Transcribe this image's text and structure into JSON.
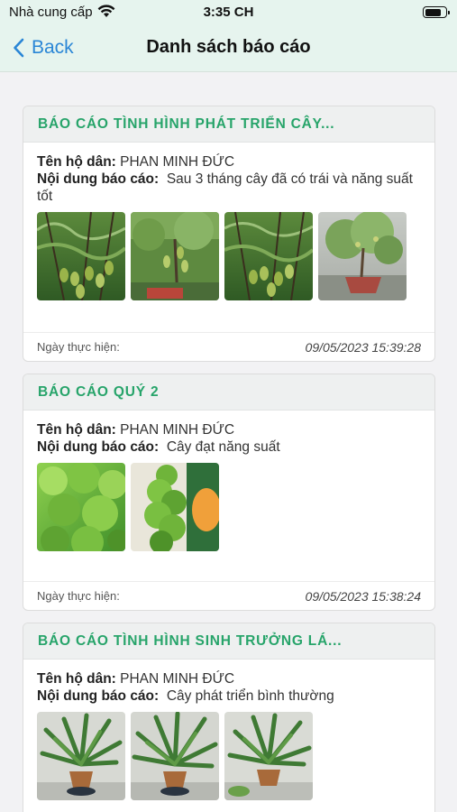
{
  "status": {
    "carrier": "Nhà cung cấp",
    "time": "3:35 CH",
    "battery_level": 0.85
  },
  "nav": {
    "back_label": "Back",
    "title": "Danh sách báo cáo"
  },
  "labels": {
    "household": "Tên hộ dân:",
    "content": "Nội dung báo cáo:",
    "date": "Ngày thực hiện:"
  },
  "reports": [
    {
      "title": "BÁO CÁO TÌNH HÌNH PHÁT TRIỂN CÂY...",
      "household": "PHAN MINH ĐỨC",
      "content": "Sau 3 tháng cây đã có trái và năng suất tốt",
      "date": "09/05/2023 15:39:28",
      "photos": [
        "fruit-tree-photo",
        "fruit-tree-photo",
        "fruit-tree-photo",
        "potted-tree-photo"
      ]
    },
    {
      "title": "BÁO CÁO QUÝ 2",
      "household": "PHAN MINH ĐỨC",
      "content": "Cây đạt năng suất",
      "date": "09/05/2023 15:38:24",
      "photos": [
        "lettuce-photo",
        "vegetable-tower-photo"
      ]
    },
    {
      "title": "BÁO CÁO TÌNH HÌNH SINH TRƯỞNG LÁ...",
      "household": "PHAN MINH ĐỨC",
      "content": "Cây phát triển bình thường",
      "date": "",
      "photos": [
        "palm-pot-photo",
        "palm-pot-photo",
        "palm-pot-photo"
      ]
    }
  ],
  "colors": {
    "accent_green": "#27a46a",
    "nav_bg": "#e6f4ee",
    "link_blue": "#2a86d6"
  }
}
